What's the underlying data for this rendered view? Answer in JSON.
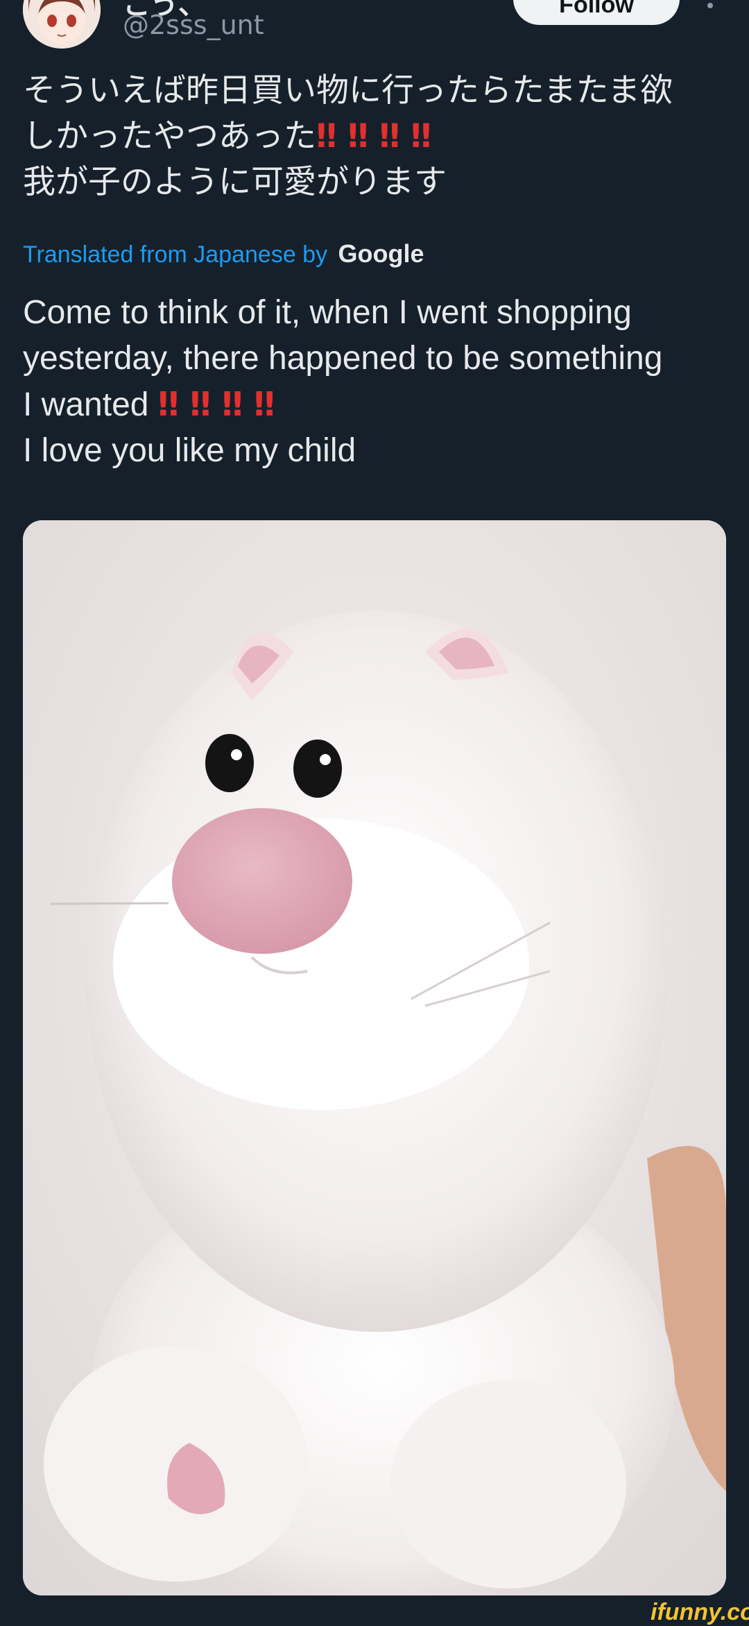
{
  "header": {
    "display_name": "こう、",
    "handle": "@2sss_unt",
    "follow_label": "Follow",
    "avatar_icon": "avatar-icon",
    "more_icon": "more-options-icon"
  },
  "tweet": {
    "original_lines": [
      "そういえば昨日買い物に行ったらたまたま欲",
      "しかったやつあった",
      "我が子のように可愛がります"
    ],
    "emphasis": "‼",
    "emphasis_count": 4,
    "translated_prefix": "Translated from Japanese by",
    "translated_brand": "Google",
    "translated_lines": [
      "Come to think of it, when I went shopping",
      "yesterday, there happened to be something",
      "I wanted",
      "I love you like my child"
    ]
  },
  "media": {
    "photo_icon": "plush-cat-photo"
  },
  "watermark": "ifunny.co",
  "colors": {
    "background": "#15202b",
    "text": "#e7e9ea",
    "secondary": "#8b98a5",
    "link": "#1d9bf0",
    "emphasis": "#e0302f",
    "watermark": "#f4c430"
  }
}
